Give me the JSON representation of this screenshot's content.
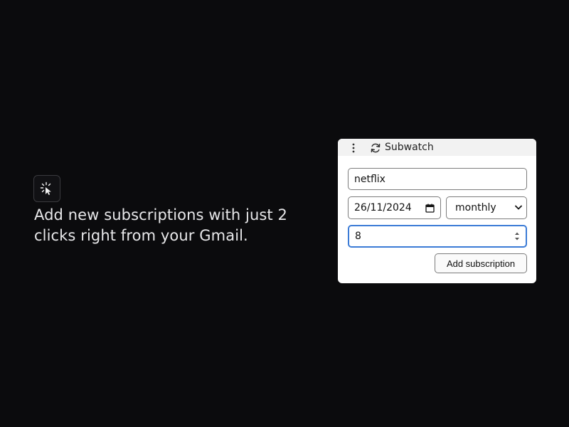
{
  "feature": {
    "icon": "cursor-click-icon",
    "text": "Add new subscriptions with just 2 clicks right from your Gmail."
  },
  "popup": {
    "menu_icon": "kebab-menu-icon",
    "logo_icon": "refresh-icon",
    "app_name": "Subwatch",
    "name_value": "netflix",
    "date_value": "26/11/2024",
    "frequency_value": "monthly",
    "amount_value": "8",
    "add_button_label": "Add subscription"
  },
  "colors": {
    "background": "#0b0b0d",
    "focus_border": "#3b7bd6"
  }
}
